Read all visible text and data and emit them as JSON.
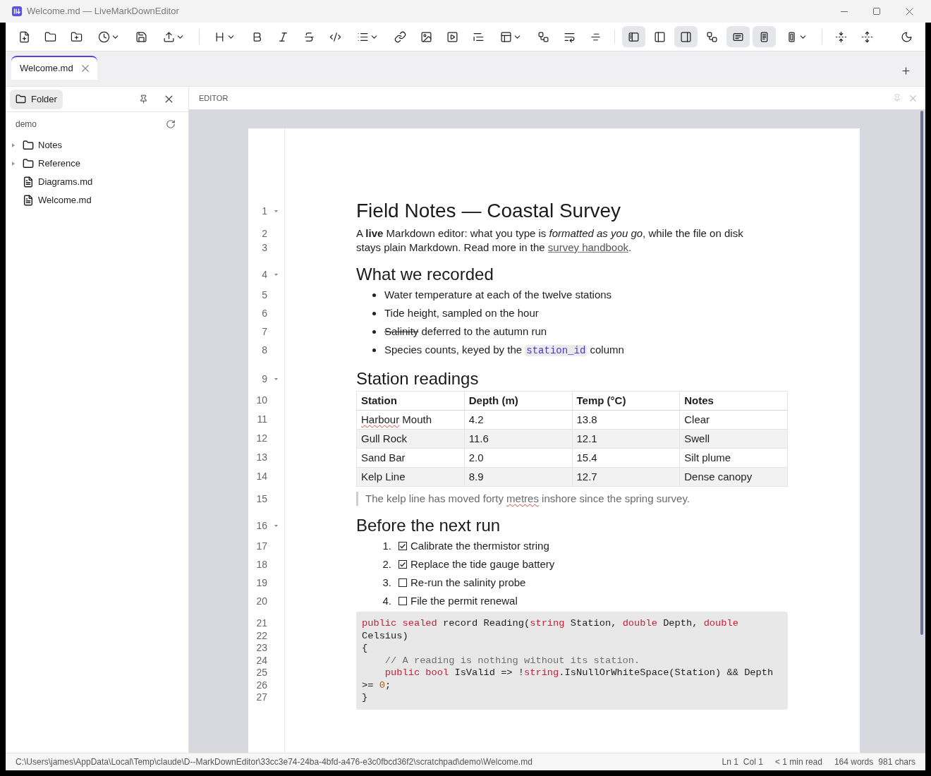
{
  "window": {
    "title": "Welcome.md — LiveMarkDownEditor"
  },
  "toolbar": {
    "groups": [
      [
        {
          "kind": "button"
        },
        {
          "kind": "button"
        },
        {
          "kind": "button"
        },
        {
          "kind": "dropdown"
        },
        {
          "kind": "button"
        },
        {
          "kind": "dropdown"
        }
      ],
      [
        {
          "kind": "dropdown"
        },
        {
          "kind": "button"
        },
        {
          "kind": "button"
        },
        {
          "kind": "button"
        },
        {
          "kind": "button"
        },
        {
          "kind": "dropdown"
        },
        {
          "kind": "button"
        },
        {
          "kind": "button"
        },
        {
          "kind": "button"
        },
        {
          "kind": "button"
        },
        {
          "kind": "dropdown"
        },
        {
          "kind": "button"
        },
        {
          "kind": "button"
        },
        {
          "kind": "button"
        }
      ],
      [
        {
          "kind": "toggle",
          "pressed": true
        },
        {
          "kind": "toggle",
          "pressed": false
        },
        {
          "kind": "toggle",
          "pressed": true
        },
        {
          "kind": "toggle",
          "pressed": false
        },
        {
          "kind": "toggle",
          "pressed": true
        },
        {
          "kind": "toggle",
          "pressed": true
        },
        {
          "kind": "dropdown"
        }
      ],
      [
        {
          "kind": "button"
        },
        {
          "kind": "button"
        }
      ]
    ],
    "trailing": [
      {
        "kind": "button"
      }
    ]
  },
  "tabs": [
    {
      "label": "Welcome.md",
      "selected": true
    }
  ],
  "sidebar": {
    "button": "Folder",
    "root": "demo",
    "tree": [
      {
        "kind": "folder",
        "label": "Notes",
        "expanded": false
      },
      {
        "kind": "folder",
        "label": "Reference",
        "expanded": false
      },
      {
        "kind": "file",
        "label": "Diagrams.md"
      },
      {
        "kind": "file",
        "label": "Welcome.md"
      }
    ]
  },
  "editor": {
    "title": "EDITOR",
    "blocks": [
      {
        "kind": "heading1",
        "line": "1",
        "text": "Field Notes — Coastal Survey"
      },
      {
        "kind": "paragraph",
        "lines": [
          "2",
          "3"
        ],
        "segments": [
          {
            "kind": "plain",
            "text": "A **live** Markdown editor: what you type is *formatted as you go*, while the file on disk stays plain Markdown. Read more in the "
          },
          {
            "kind": "link",
            "text": "survey handbook"
          },
          {
            "kind": "plain",
            "text": "."
          }
        ]
      },
      {
        "kind": "heading2",
        "line": "4",
        "text": "What we recorded"
      },
      {
        "kind": "bullets",
        "items": [
          {
            "line": "5",
            "segments": [
              {
                "kind": "plain",
                "text": "Water temperature at each of the twelve stations"
              }
            ]
          },
          {
            "line": "6",
            "segments": [
              {
                "kind": "plain",
                "text": "Tide height, sampled on the hour"
              }
            ]
          },
          {
            "line": "7",
            "segments": [
              {
                "kind": "strike",
                "text": "Salinity"
              },
              {
                "kind": "plain",
                "text": " deferred to the autumn run"
              }
            ]
          },
          {
            "line": "8",
            "segments": [
              {
                "kind": "plain",
                "text": "Species counts, keyed by the "
              },
              {
                "kind": "code",
                "text": "station_id"
              },
              {
                "kind": "plain",
                "text": " column"
              }
            ]
          }
        ]
      },
      {
        "kind": "heading2",
        "line": "9",
        "text": "Station readings"
      },
      {
        "kind": "table",
        "header_line": "10",
        "columns": [
          "Station",
          "Depth (m)",
          "Temp (°C)",
          "Notes"
        ],
        "rows": [
          {
            "line": "11",
            "cells": [
              [
                {
                  "kind": "misspelled",
                  "text": "Harbour"
                },
                {
                  "kind": "plain",
                  "text": " Mouth"
                }
              ],
              "4.2",
              "13.8",
              "Clear"
            ]
          },
          {
            "line": "12",
            "cells": [
              "Gull Rock",
              "11.6",
              "12.1",
              "Swell"
            ]
          },
          {
            "line": "13",
            "cells": [
              "Sand Bar",
              "2.0",
              "15.4",
              "Silt plume"
            ]
          },
          {
            "line": "14",
            "cells": [
              "Kelp Line",
              "8.9",
              "12.7",
              "Dense canopy"
            ]
          }
        ]
      },
      {
        "kind": "quote",
        "line": "15",
        "segments": [
          {
            "kind": "plain",
            "text": "The kelp line has moved forty "
          },
          {
            "kind": "misspelled",
            "text": "metres"
          },
          {
            "kind": "plain",
            "text": " inshore since the spring survey."
          }
        ]
      },
      {
        "kind": "heading2",
        "line": "16",
        "text": "Before the next run"
      },
      {
        "kind": "tasks",
        "items": [
          {
            "line": "17",
            "number": "1.",
            "checked": true,
            "text": "Calibrate the thermistor string"
          },
          {
            "line": "18",
            "number": "2.",
            "checked": true,
            "text": "Replace the tide gauge battery"
          },
          {
            "line": "19",
            "number": "3.",
            "checked": false,
            "text": "Re-run the salinity probe"
          },
          {
            "line": "20",
            "number": "4.",
            "checked": false,
            "text": "File the permit renewal"
          }
        ]
      },
      {
        "kind": "code",
        "lines": [
          {
            "line": "21",
            "tokens": [
              {
                "kind": "keyword",
                "text": "public sealed"
              },
              {
                "kind": "plain",
                "text": " record Reading("
              },
              {
                "kind": "keyword",
                "text": "string"
              },
              {
                "kind": "plain",
                "text": " Station, "
              },
              {
                "kind": "keyword",
                "text": "double"
              },
              {
                "kind": "plain",
                "text": " Depth, "
              },
              {
                "kind": "keyword",
                "text": "double"
              }
            ]
          },
          {
            "line": "22",
            "tokens": [
              {
                "kind": "plain",
                "text": "Celsius)"
              }
            ]
          },
          {
            "line": "23",
            "tokens": [
              {
                "kind": "plain",
                "text": "{"
              }
            ]
          },
          {
            "line": "24",
            "tokens": [
              {
                "kind": "comment",
                "text": "    // A reading is nothing without its station."
              }
            ]
          },
          {
            "line": "25",
            "tokens": [
              {
                "kind": "keyword",
                "text": "    public bool"
              },
              {
                "kind": "plain",
                "text": " IsValid => !"
              },
              {
                "kind": "keyword",
                "text": "string"
              },
              {
                "kind": "plain",
                "text": ".IsNullOrWhiteSpace(Station) && Depth"
              }
            ]
          },
          {
            "line": "26",
            "tokens": [
              {
                "kind": "plain",
                "text": ">= "
              },
              {
                "kind": "number",
                "text": "0"
              },
              {
                "kind": "plain",
                "text": ";"
              }
            ]
          },
          {
            "line": "27",
            "tokens": [
              {
                "kind": "plain",
                "text": "}"
              }
            ]
          }
        ]
      }
    ]
  },
  "status_bar": {
    "path": "C:\\Users\\james\\AppData\\Local\\Temp\\claude\\D--MarkDownEditor\\33cc3e74-24ba-4bfd-a476-e3c0fbcd36f2\\scratchpad\\demo\\Welcome.md",
    "position": [
      "Ln 1",
      "Col 1"
    ],
    "read_time": "< 1 min read",
    "counts": [
      "164 words",
      "981 chars"
    ]
  }
}
